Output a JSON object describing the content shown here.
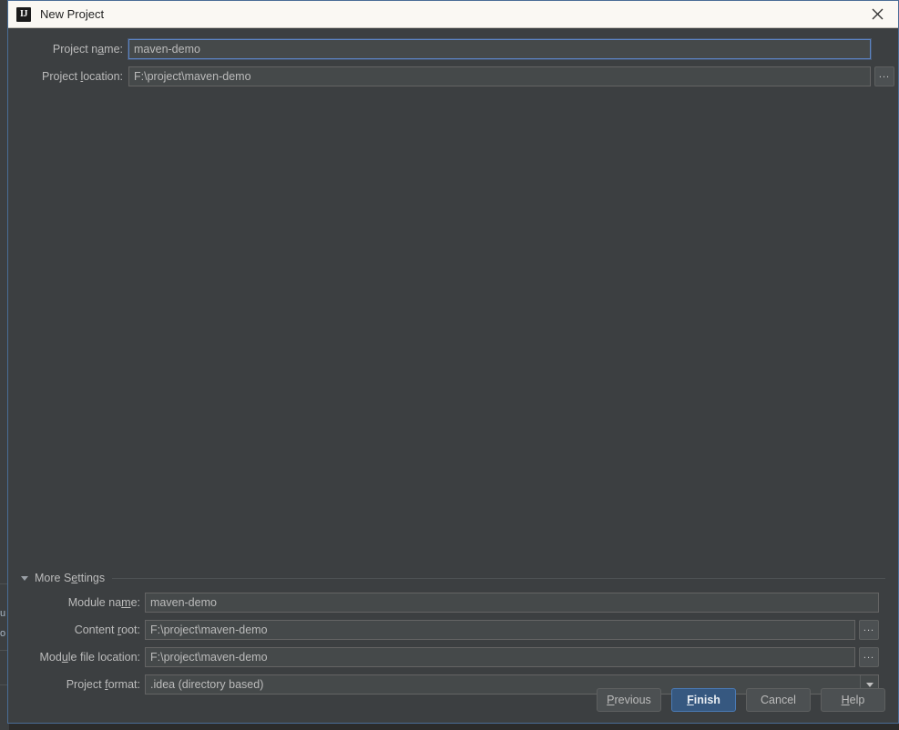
{
  "window": {
    "title": "New Project",
    "logo_icon": "intellij-idea-logo",
    "close_icon": "close-icon"
  },
  "top_fields": [
    {
      "label_pre": "Project n",
      "label_mnemonic": "a",
      "label_post": "me:",
      "name": "project-name",
      "value": "maven-demo",
      "focused": true,
      "has_browse": false
    },
    {
      "label_pre": "Project ",
      "label_mnemonic": "l",
      "label_post": "ocation:",
      "name": "project-location",
      "value": "F:\\project\\maven-demo",
      "focused": false,
      "has_browse": true
    }
  ],
  "more_settings": {
    "label": "More Settings",
    "expanded": true,
    "triangle_icon": "triangle-down-icon"
  },
  "settings_fields": [
    {
      "label_pre": "Module na",
      "label_mnemonic": "m",
      "label_post": "e:",
      "name": "module-name",
      "value": "maven-demo",
      "type": "text",
      "has_browse": false
    },
    {
      "label_pre": "Content ",
      "label_mnemonic": "r",
      "label_post": "oot:",
      "name": "content-root",
      "value": "F:\\project\\maven-demo",
      "type": "text",
      "has_browse": true
    },
    {
      "label_pre": "Mod",
      "label_mnemonic": "u",
      "label_post": "le file location:",
      "name": "module-file-location",
      "value": "F:\\project\\maven-demo",
      "type": "text",
      "has_browse": true
    },
    {
      "label_pre": "Project ",
      "label_mnemonic": "f",
      "label_post": "ormat:",
      "name": "project-format",
      "value": ".idea (directory based)",
      "type": "combo",
      "has_browse": false,
      "arrow_icon": "chevron-down-icon"
    }
  ],
  "browse_button_label": "...",
  "buttons": [
    {
      "name": "previous",
      "pre": "",
      "mnemonic": "P",
      "post": "revious",
      "default": false
    },
    {
      "name": "finish",
      "pre": "",
      "mnemonic": "F",
      "post": "inish",
      "default": true
    },
    {
      "name": "cancel",
      "pre": "C",
      "mnemonic": "",
      "post": "ancel",
      "default": false
    },
    {
      "name": "help",
      "pre": "",
      "mnemonic": "H",
      "post": "elp",
      "default": false
    }
  ],
  "colors": {
    "dialog_bg": "#3c3f41",
    "titlebar_bg": "#faf8f3",
    "field_bg": "#45494a",
    "accent_blue": "#365880",
    "focus_border": "#5c84c4",
    "dialog_border": "#4a6d96",
    "text": "#bbbbbb"
  }
}
